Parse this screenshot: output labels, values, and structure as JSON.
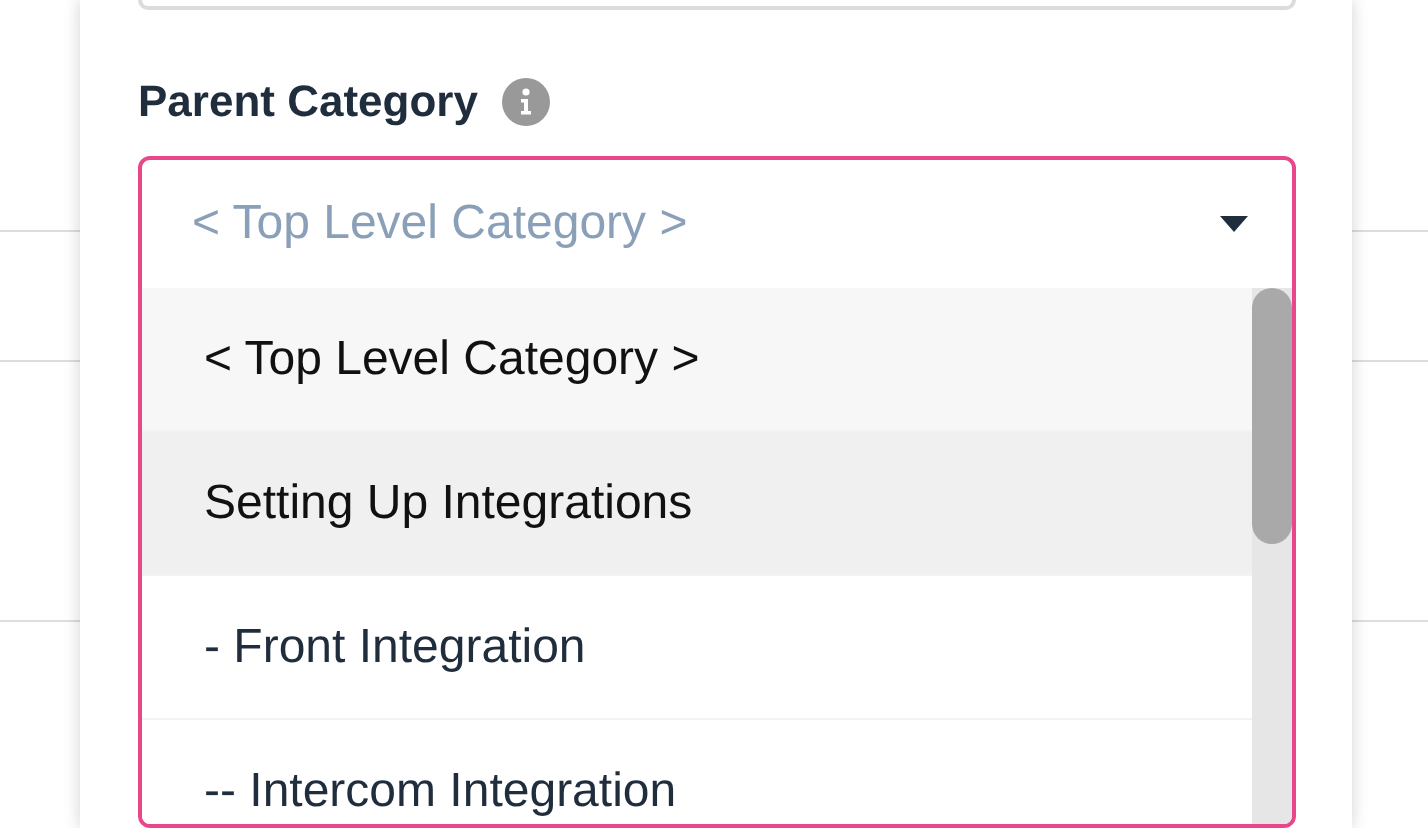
{
  "field": {
    "label": "Parent Category",
    "placeholder": "< Top Level Category >",
    "expanded": true
  },
  "options": [
    {
      "label": "< Top Level Category >",
      "selected": true,
      "highlighted": false
    },
    {
      "label": "Setting Up Integrations",
      "selected": false,
      "highlighted": true
    },
    {
      "label": "- Front Integration",
      "selected": false,
      "highlighted": false
    },
    {
      "label": "-- Intercom Integration",
      "selected": false,
      "highlighted": false
    }
  ]
}
